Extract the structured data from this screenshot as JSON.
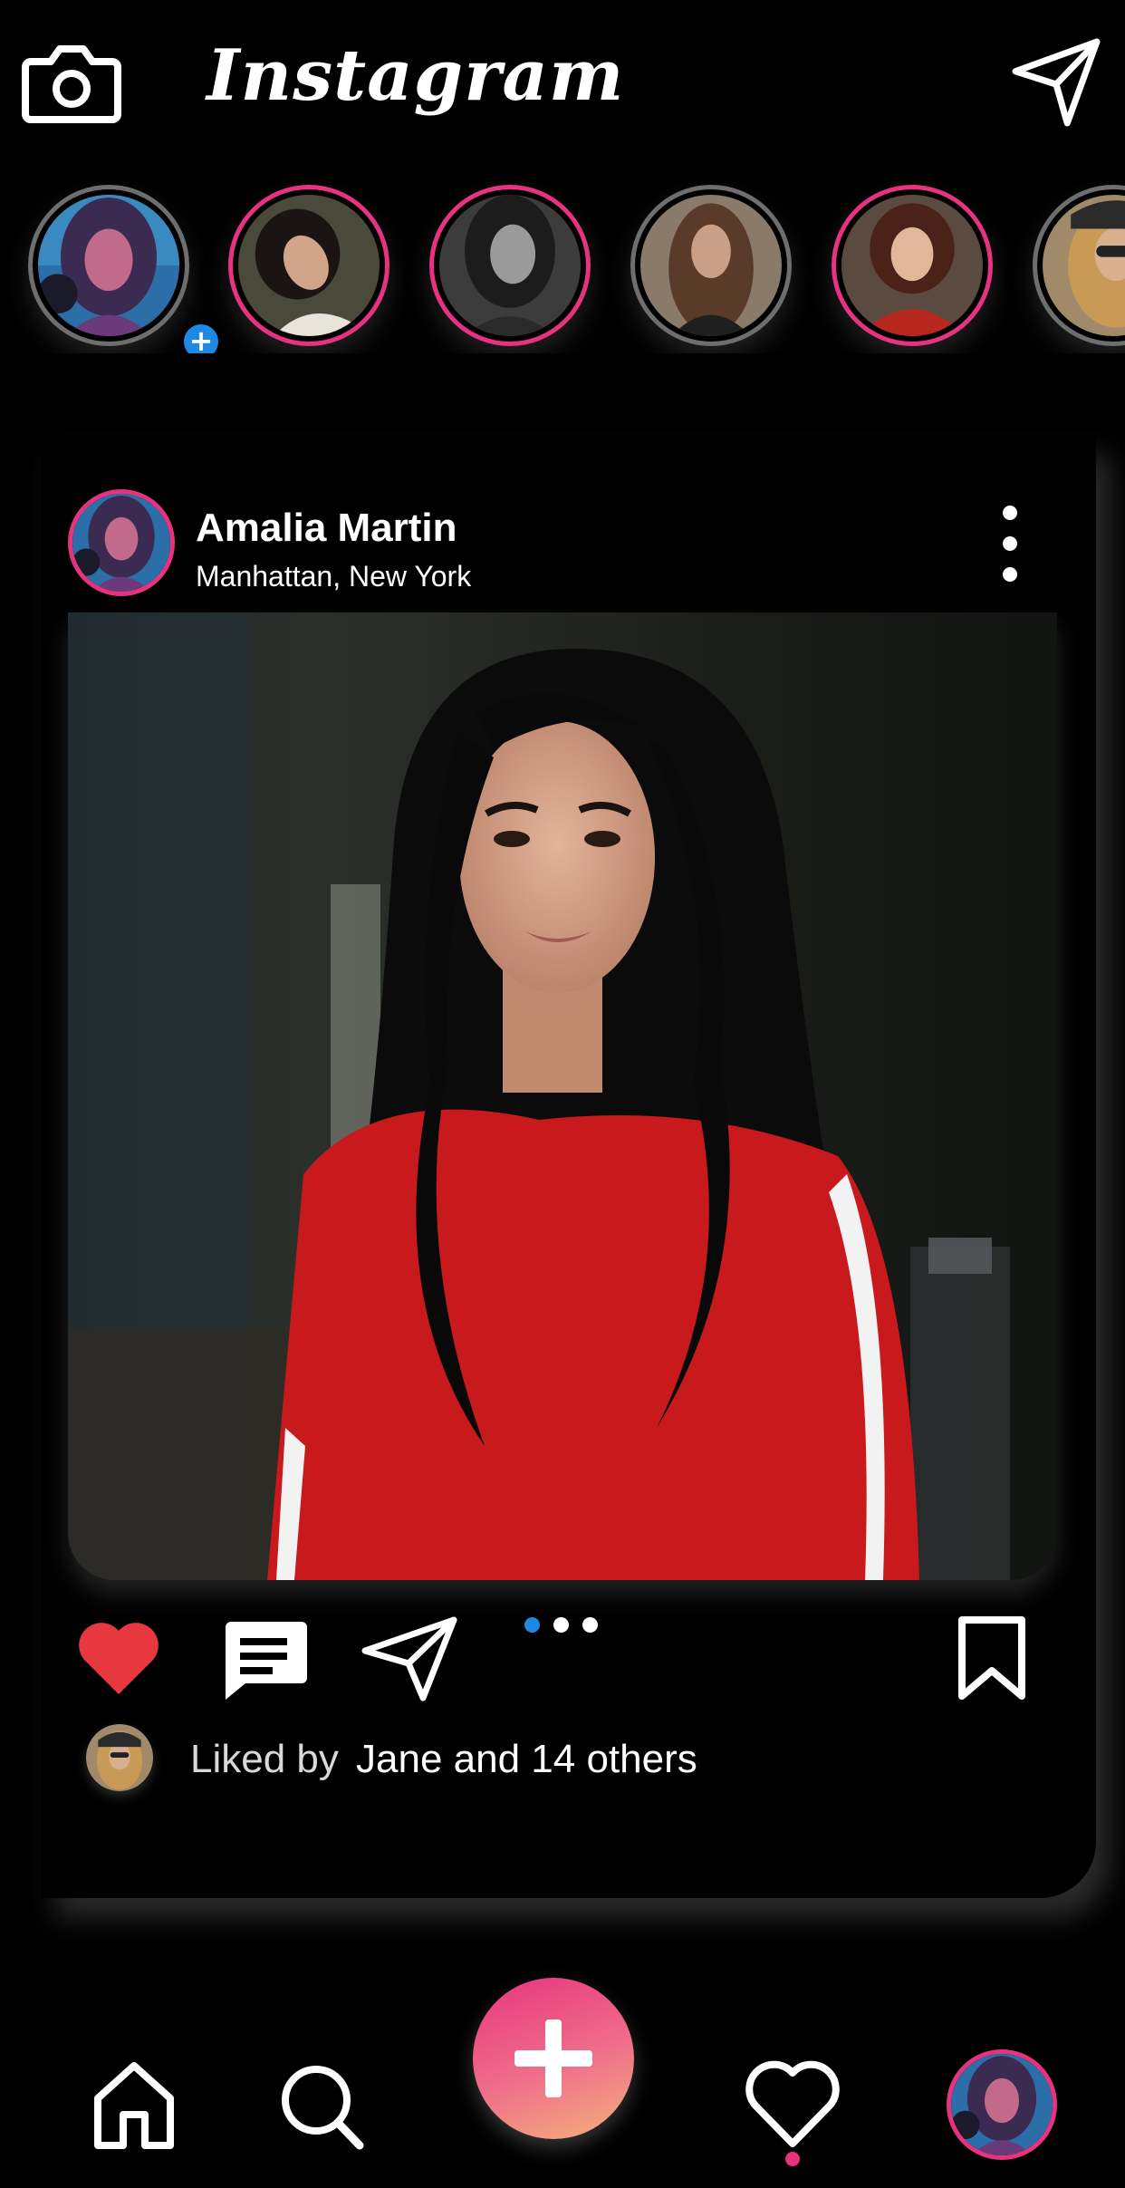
{
  "app": {
    "title": "Instagram"
  },
  "header": {
    "camera_icon": "camera-icon",
    "direct_icon": "paper-plane-icon"
  },
  "stories": [
    {
      "name": "your-story",
      "ring": "gray",
      "add_badge": "+",
      "skin": "#c26a8a",
      "hair": "#3b2a52",
      "bg": "#2b6ea8"
    },
    {
      "name": "story-2",
      "ring": "pink",
      "skin": "#d2a48a",
      "hair": "#1a1512",
      "bg": "#4a4a3a"
    },
    {
      "name": "story-3",
      "ring": "pink",
      "skin": "#9a9a9a",
      "hair": "#1c1c1c",
      "bg": "#3c3c3c"
    },
    {
      "name": "story-4",
      "ring": "gray",
      "skin": "#c9a085",
      "hair": "#5a3a28",
      "bg": "#8a7a6a"
    },
    {
      "name": "story-5",
      "ring": "pink",
      "skin": "#e0b79a",
      "hair": "#4a2218",
      "bg": "#7a2420"
    },
    {
      "name": "story-6",
      "ring": "gray",
      "skin": "#d8b090",
      "hair": "#c89a55",
      "bg": "#a08a6a"
    }
  ],
  "post": {
    "username": "Amalia Martin",
    "location": "Manhattan, New York",
    "more_icon": "more-vertical-icon",
    "image_alt": "Woman with long dark hair in a red sweatshirt",
    "carousel": {
      "count": 3,
      "active_index": 0
    },
    "liked_prefix": "Liked by",
    "liked_rest": "Jane and 14 others"
  },
  "actions": {
    "like_icon": "heart-filled-icon",
    "comment_icon": "comment-icon",
    "share_icon": "paper-plane-icon",
    "save_icon": "bookmark-icon"
  },
  "nav": {
    "home_icon": "home-icon",
    "search_icon": "search-icon",
    "create_icon": "plus-icon",
    "activity_icon": "heart-outline-icon",
    "profile": "profile-avatar"
  },
  "colors": {
    "background": "#000000",
    "accent_pink": "#e6337f",
    "like_red": "#e8383f",
    "carousel_active": "#1e88e5",
    "create_gradient": [
      "#e8357e",
      "#ef6f8a",
      "#f5b27c"
    ]
  }
}
